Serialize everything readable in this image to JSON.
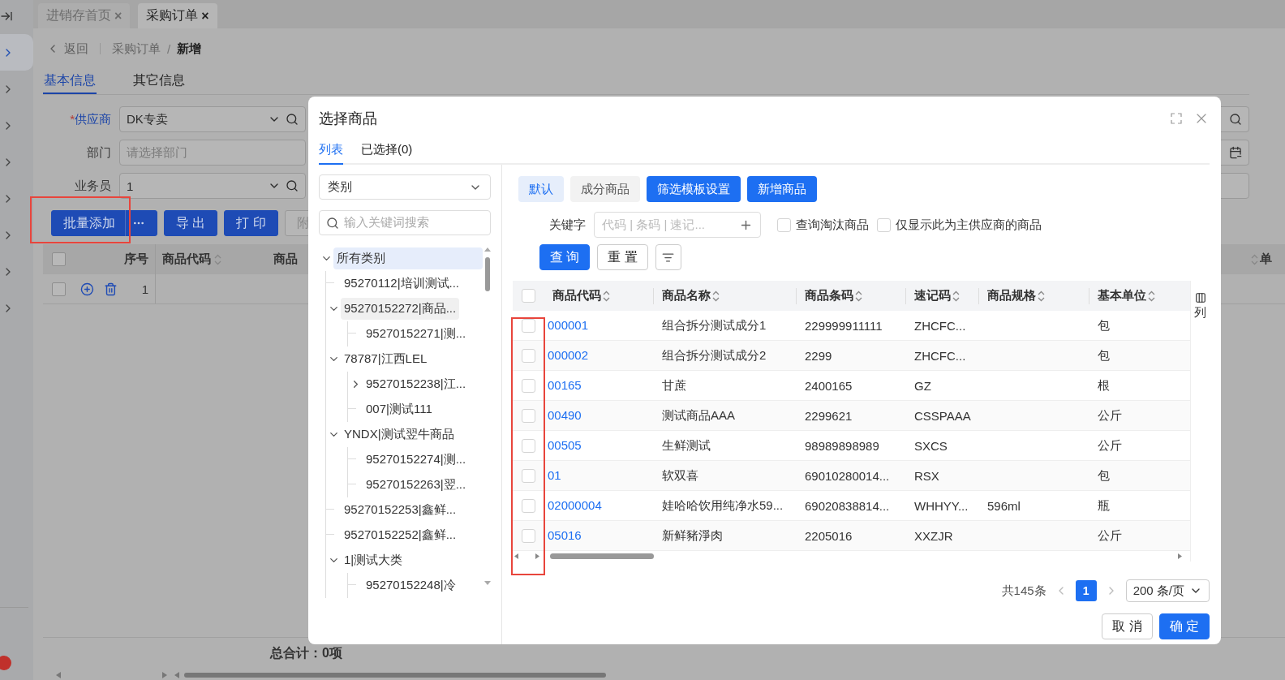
{
  "sidebar": {
    "items": [
      {
        "selected": true
      },
      {
        "selected": false
      },
      {
        "selected": false
      },
      {
        "selected": false
      },
      {
        "selected": false
      },
      {
        "selected": false
      },
      {
        "selected": false
      },
      {
        "selected": false
      }
    ]
  },
  "page_tabs": [
    {
      "label": "进销存首页",
      "close": "×",
      "selected": false
    },
    {
      "label": "采购订单",
      "close": "×",
      "selected": true
    }
  ],
  "breadcrumb": {
    "back": "返回",
    "items": [
      "采购订单",
      "新增"
    ],
    "separator": "/"
  },
  "form_tabs": [
    {
      "label": "基本信息",
      "selected": true
    },
    {
      "label": "其它信息",
      "selected": false
    }
  ],
  "form": [
    {
      "label": "供应商",
      "marker": "*",
      "kind": "select-search",
      "value": "DK专卖"
    },
    {
      "label": "部门",
      "kind": "input",
      "placeholder": "请选择部门"
    },
    {
      "label": "业务员",
      "kind": "select-search",
      "value": "1"
    }
  ],
  "side_fields": [
    {
      "kind": "select-search"
    },
    {
      "kind": "date"
    },
    {
      "kind": "input"
    }
  ],
  "actions": [
    {
      "label": "批量添加",
      "kind": "split"
    },
    {
      "label": "导 出",
      "kind": "primary"
    },
    {
      "label": "打 印",
      "kind": "primary"
    },
    {
      "label": "附",
      "kind": "default"
    }
  ],
  "order_table": {
    "all_checked": false,
    "columns": [
      "序号",
      "商品代码",
      "商品"
    ],
    "last_column": "单",
    "rows": [
      {
        "checked": false,
        "index": "1"
      }
    ],
    "total": "总合计：0项"
  },
  "modal": {
    "title": "选择商品",
    "tabs": [
      {
        "label": "列表",
        "selected": true
      },
      {
        "label": "已选择(0)",
        "selected": false
      }
    ],
    "category_select": "类别",
    "tree_search": "输入关键词搜索",
    "tree": [
      {
        "label": "所有类别",
        "expanded": true,
        "selected": true,
        "hovered": false,
        "children": [
          {
            "label": "95270112|培训测试...",
            "selected": false,
            "hovered": false
          },
          {
            "label": "95270152272|商品...",
            "expanded": true,
            "selected": false,
            "hovered": true,
            "children": [
              {
                "label": "95270152271|测...",
                "selected": false,
                "hovered": false
              }
            ]
          },
          {
            "label": "78787|江西LEL",
            "expanded": true,
            "selected": false,
            "hovered": false,
            "children": [
              {
                "label": "95270152238|江...",
                "expanded": false,
                "selected": false,
                "hovered": false
              },
              {
                "label": "007|测试111",
                "selected": false,
                "hovered": false
              }
            ]
          },
          {
            "label": "YNDX|测试翌牛商品",
            "expanded": true,
            "selected": false,
            "hovered": false,
            "children": [
              {
                "label": "95270152274|测...",
                "selected": false,
                "hovered": false
              },
              {
                "label": "95270152263|翌...",
                "selected": false,
                "hovered": false
              }
            ]
          },
          {
            "label": "95270152253|鑫鲜...",
            "selected": false,
            "hovered": false
          },
          {
            "label": "95270152252|鑫鲜...",
            "selected": false,
            "hovered": false
          },
          {
            "label": "1|测试大类",
            "expanded": true,
            "selected": false,
            "hovered": false,
            "children": [
              {
                "label": "95270152248|冷",
                "selected": false,
                "hovered": false
              }
            ]
          }
        ]
      }
    ],
    "views": [
      {
        "label": "默认",
        "selected": true
      },
      {
        "label": "成分商品",
        "selected": false
      }
    ],
    "tool_buttons": [
      "筛选模板设置",
      "新增商品"
    ],
    "keyword": {
      "label": "关键字",
      "placeholder": "代码 | 条码 | 速记..."
    },
    "options": [
      {
        "label": "查询淘汰商品",
        "checked": false
      },
      {
        "label": "仅显示此为主供应商的商品",
        "checked": false
      }
    ],
    "query_button": "查 询",
    "reset_button": "重 置",
    "table": {
      "all_checked": false,
      "columns": [
        "商品代码",
        "商品名称",
        "商品条码",
        "速记码",
        "商品规格",
        "基本单位"
      ],
      "column_settings": "列",
      "rows": [
        {
          "checked": false,
          "cells": [
            "000001",
            "组合拆分测试成分1",
            "229999911111",
            "ZHCFC...",
            "",
            "包"
          ]
        },
        {
          "checked": false,
          "cells": [
            "000002",
            "组合拆分测试成分2",
            "2299",
            "ZHCFC...",
            "",
            "包"
          ]
        },
        {
          "checked": false,
          "cells": [
            "00165",
            "甘蔗",
            "2400165",
            "GZ",
            "",
            "根"
          ]
        },
        {
          "checked": false,
          "cells": [
            "00490",
            "测试商品AAA",
            "2299621",
            "CSSPAAA",
            "",
            "公斤"
          ]
        },
        {
          "checked": false,
          "cells": [
            "00505",
            "生鲜测试",
            "98989898989",
            "SXCS",
            "",
            "公斤"
          ]
        },
        {
          "checked": false,
          "cells": [
            "01",
            "软双喜",
            "69010280014...",
            "RSX",
            "",
            "包"
          ]
        },
        {
          "checked": false,
          "cells": [
            "02000004",
            "娃哈哈饮用纯净水59...",
            "69020838814...",
            "WHHYY...",
            "596ml",
            "瓶"
          ]
        },
        {
          "checked": false,
          "cells": [
            "05016",
            "新鲜豬淨肉",
            "2205016",
            "XXZJR",
            "",
            "公斤"
          ]
        }
      ]
    },
    "pagination": {
      "total": "共145条",
      "pages": [
        {
          "label": "1",
          "selected": true
        }
      ],
      "page_size": "200 条/页"
    },
    "footer": {
      "cancel": "取 消",
      "ok": "确 定"
    }
  }
}
